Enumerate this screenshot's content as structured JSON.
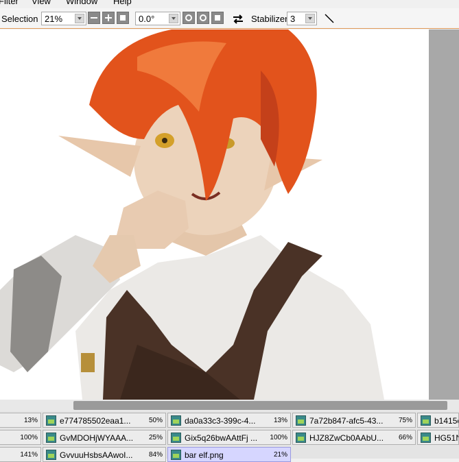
{
  "menu": [
    "Filter",
    "View",
    "Window",
    "Help"
  ],
  "toolbar": {
    "selection_label": "Selection",
    "zoom": "21%",
    "angle": "0.0°",
    "stabilizer_label": "Stabilizer",
    "stabilizer_value": "3"
  },
  "tabs": [
    {
      "name": "",
      "zoom": "13%"
    },
    {
      "name": "e774785502eaa1...",
      "zoom": "50%"
    },
    {
      "name": "da0a33c3-399c-4...",
      "zoom": "13%"
    },
    {
      "name": "7a72b847-afc5-43...",
      "zoom": "75%"
    },
    {
      "name": "b1415c",
      "zoom": ""
    },
    {
      "name": "",
      "zoom": "100%"
    },
    {
      "name": "GvMDOHjWYAAA...",
      "zoom": "25%"
    },
    {
      "name": "Gix5q26bwAAttFj ...",
      "zoom": "100%"
    },
    {
      "name": "HJZ8ZwCb0AAbU...",
      "zoom": "66%"
    },
    {
      "name": "HG51N",
      "zoom": ""
    },
    {
      "name": "",
      "zoom": "141%"
    },
    {
      "name": "GvvuuHsbsAAwoI...",
      "zoom": "84%"
    },
    {
      "name": "bar elf.png",
      "zoom": "21%"
    }
  ]
}
